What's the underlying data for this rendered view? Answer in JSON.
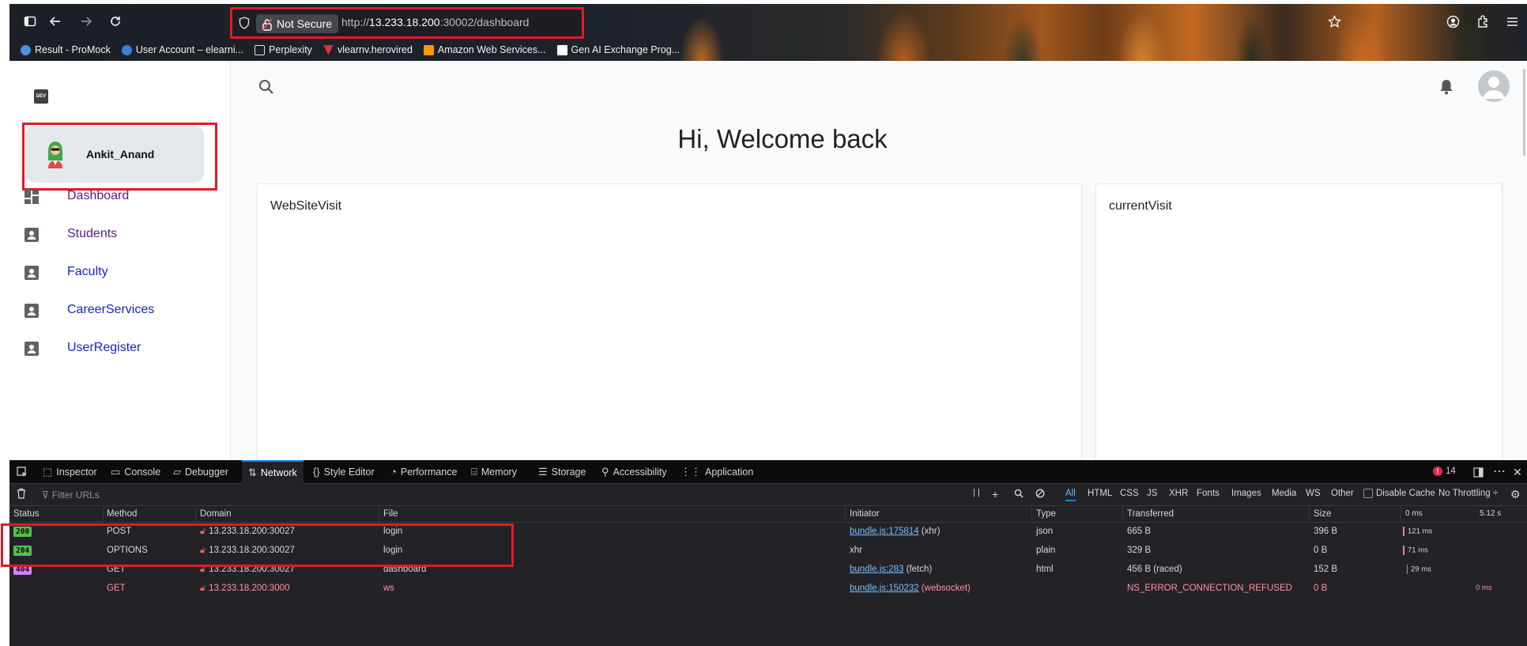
{
  "browser": {
    "not_secure_label": "Not Secure",
    "url_prefix": "http://",
    "url_host": "13.233.18.200",
    "url_rest": ":30002/dashboard",
    "bookmarks": [
      {
        "label": "Result - ProMock",
        "color": "#4a90e2"
      },
      {
        "label": "User Account – elearni...",
        "color": "#3b7dd8"
      },
      {
        "label": "Perplexity",
        "color": "#e5e5e5"
      },
      {
        "label": "vlearnv.herovired",
        "color": "#e0303a"
      },
      {
        "label": "Amazon Web Services...",
        "color": "#ff9900"
      },
      {
        "label": "Gen AI Exchange Prog...",
        "color": "#ffffff"
      }
    ]
  },
  "app": {
    "logo_text": "DEV",
    "user_name": "Ankit_Anand",
    "nav": [
      {
        "label": "Dashboard",
        "color": "#5b1a8a",
        "icon": "dashboard-icon"
      },
      {
        "label": "Students",
        "color": "#5b1a8a",
        "icon": "contact-card-icon"
      },
      {
        "label": "Faculty",
        "color": "#1a22c8",
        "icon": "contact-card-icon"
      },
      {
        "label": "CareerServices",
        "color": "#1a22c8",
        "icon": "contact-card-icon"
      },
      {
        "label": "UserRegister",
        "color": "#1a22c8",
        "icon": "contact-card-icon"
      }
    ],
    "welcome": "Hi, Welcome back",
    "cards": [
      {
        "title": "WebSiteVisit"
      },
      {
        "title": "currentVisit"
      }
    ]
  },
  "devtools": {
    "tabs": [
      {
        "label": "Inspector",
        "icon": "inspector-icon"
      },
      {
        "label": "Console",
        "icon": "console-icon"
      },
      {
        "label": "Debugger",
        "icon": "debugger-icon"
      },
      {
        "label": "Network",
        "icon": "network-icon",
        "active": true
      },
      {
        "label": "Style Editor",
        "icon": "style-editor-icon"
      },
      {
        "label": "Performance",
        "icon": "performance-icon"
      },
      {
        "label": "Memory",
        "icon": "memory-icon"
      },
      {
        "label": "Storage",
        "icon": "storage-icon"
      },
      {
        "label": "Accessibility",
        "icon": "accessibility-icon"
      },
      {
        "label": "Application",
        "icon": "application-icon"
      }
    ],
    "error_count": "14",
    "filter_placeholder": "Filter URLs",
    "filter_types": [
      "All",
      "HTML",
      "CSS",
      "JS",
      "XHR",
      "Fonts",
      "Images",
      "Media",
      "WS",
      "Other"
    ],
    "disable_cache_label": "Disable Cache",
    "throttling_label": "No Throttling ÷",
    "columns": [
      "Status",
      "Method",
      "Domain",
      "File",
      "Initiator",
      "Type",
      "Transferred",
      "Size",
      "0 ms",
      "5.12 s"
    ],
    "rows": [
      {
        "status": "200",
        "status_color": "#51c14a",
        "method": "POST",
        "domain": "13.233.18.200:30027",
        "file": "login",
        "initiator_link": "bundle.js:175814",
        "initiator_extra": " (xhr)",
        "type": "json",
        "transferred": "665 B",
        "size": "396 B",
        "timing": "121 ms",
        "error": false
      },
      {
        "status": "204",
        "status_color": "#51c14a",
        "method": "OPTIONS",
        "domain": "13.233.18.200:30027",
        "file": "login",
        "initiator_link": "",
        "initiator_extra": "xhr",
        "type": "plain",
        "transferred": "329 B",
        "size": "0 B",
        "timing": "71 ms",
        "error": false
      },
      {
        "status": "404",
        "status_color": "#d980ff",
        "method": "GET",
        "domain": "13.233.18.200:30027",
        "file": "dashboard",
        "initiator_link": "bundle.js:283",
        "initiator_extra": " (fetch)",
        "type": "html",
        "transferred": "456 B (raced)",
        "size": "152 B",
        "timing": "29 ms",
        "error": false
      },
      {
        "status": "",
        "status_color": "",
        "method": "GET",
        "domain": "13.233.18.200:3000",
        "file": "ws",
        "initiator_link": "bundle.js:150232",
        "initiator_extra": " (websocket)",
        "type": "",
        "transferred": "NS_ERROR_CONNECTION_REFUSED",
        "size": "0 B",
        "timing": "0 ms",
        "error": true
      }
    ]
  }
}
